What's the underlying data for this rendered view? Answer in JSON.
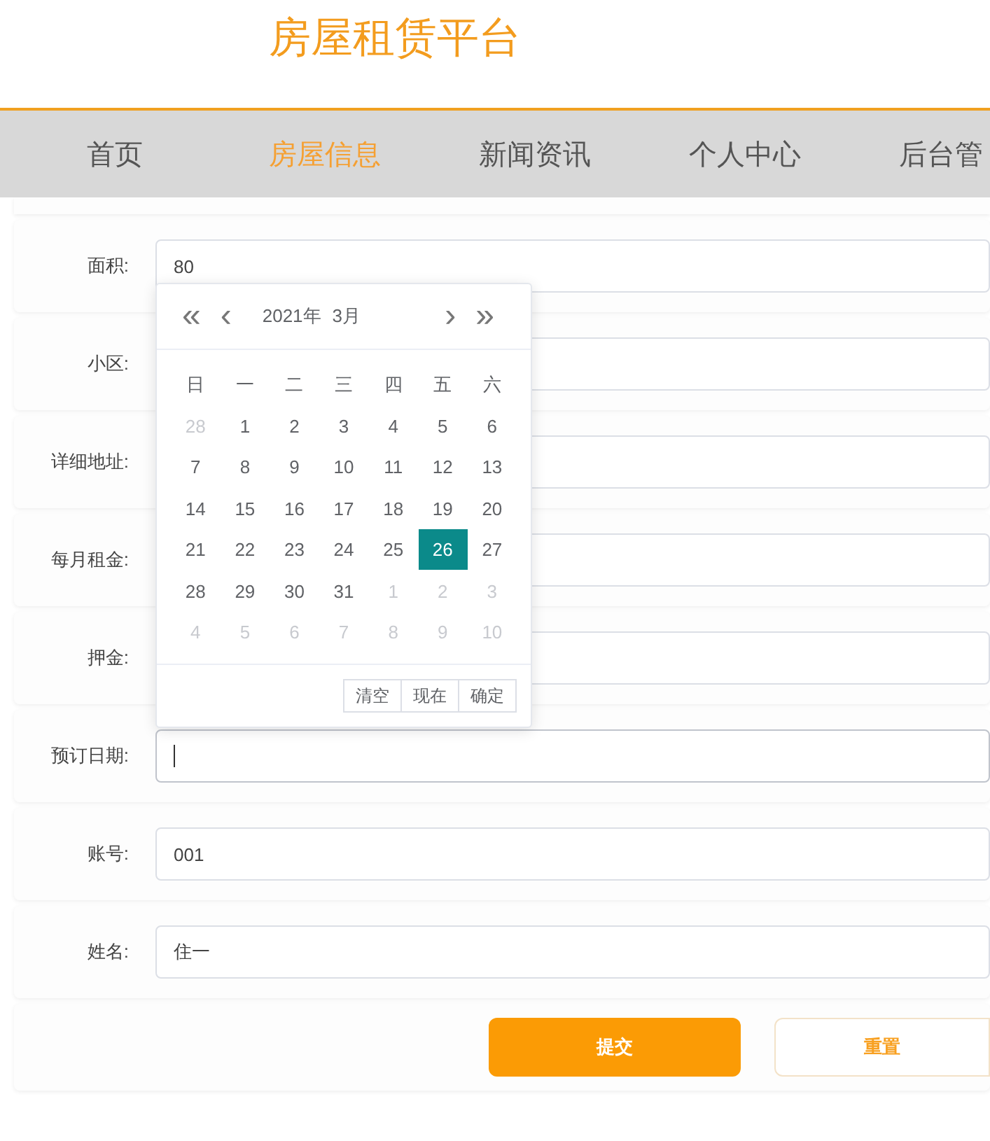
{
  "site_title": "房屋租赁平台",
  "nav": [
    {
      "label": "首页",
      "selected": false
    },
    {
      "label": "房屋信息",
      "selected": true
    },
    {
      "label": "新闻资讯",
      "selected": false
    },
    {
      "label": "个人中心",
      "selected": false
    },
    {
      "label": "后台管",
      "selected": false
    }
  ],
  "form": {
    "fields": [
      {
        "label": "面积:",
        "value": "80",
        "focused": false
      },
      {
        "label": "小区:",
        "focused": false
      },
      {
        "label": "详细地址:",
        "focused": false
      },
      {
        "label": "每月租金:",
        "focused": false
      },
      {
        "label": "押金:",
        "focused": false
      },
      {
        "label": "预订日期:",
        "focused": true
      },
      {
        "label": "账号:",
        "value": "001",
        "focused": false
      },
      {
        "label": "姓名:",
        "value": "住一",
        "focused": false
      }
    ],
    "buttons": [
      {
        "label": "提交",
        "kind": "primary"
      },
      {
        "label": "重置",
        "kind": "secondary"
      }
    ]
  },
  "date_picker": {
    "prev_year": "«",
    "prev_month": "‹",
    "year": "2021年",
    "month": "3月",
    "next_month": "›",
    "next_year": "»",
    "weekdays": [
      "日",
      "一",
      "二",
      "三",
      "四",
      "五",
      "六"
    ],
    "days": [
      {
        "label": "28",
        "other_month": true,
        "selected": false
      },
      {
        "label": "1",
        "other_month": false,
        "selected": false
      },
      {
        "label": "2",
        "other_month": false,
        "selected": false
      },
      {
        "label": "3",
        "other_month": false,
        "selected": false
      },
      {
        "label": "4",
        "other_month": false,
        "selected": false
      },
      {
        "label": "5",
        "other_month": false,
        "selected": false
      },
      {
        "label": "6",
        "other_month": false,
        "selected": false
      },
      {
        "label": "7",
        "other_month": false,
        "selected": false
      },
      {
        "label": "8",
        "other_month": false,
        "selected": false
      },
      {
        "label": "9",
        "other_month": false,
        "selected": false
      },
      {
        "label": "10",
        "other_month": false,
        "selected": false
      },
      {
        "label": "11",
        "other_month": false,
        "selected": false
      },
      {
        "label": "12",
        "other_month": false,
        "selected": false
      },
      {
        "label": "13",
        "other_month": false,
        "selected": false
      },
      {
        "label": "14",
        "other_month": false,
        "selected": false
      },
      {
        "label": "15",
        "other_month": false,
        "selected": false
      },
      {
        "label": "16",
        "other_month": false,
        "selected": false
      },
      {
        "label": "17",
        "other_month": false,
        "selected": false
      },
      {
        "label": "18",
        "other_month": false,
        "selected": false
      },
      {
        "label": "19",
        "other_month": false,
        "selected": false
      },
      {
        "label": "20",
        "other_month": false,
        "selected": false
      },
      {
        "label": "21",
        "other_month": false,
        "selected": false
      },
      {
        "label": "22",
        "other_month": false,
        "selected": false
      },
      {
        "label": "23",
        "other_month": false,
        "selected": false
      },
      {
        "label": "24",
        "other_month": false,
        "selected": false
      },
      {
        "label": "25",
        "other_month": false,
        "selected": false
      },
      {
        "label": "26",
        "other_month": false,
        "selected": true
      },
      {
        "label": "27",
        "other_month": false,
        "selected": false
      },
      {
        "label": "28",
        "other_month": false,
        "selected": false
      },
      {
        "label": "29",
        "other_month": false,
        "selected": false
      },
      {
        "label": "30",
        "other_month": false,
        "selected": false
      },
      {
        "label": "31",
        "other_month": false,
        "selected": false
      },
      {
        "label": "1",
        "other_month": true,
        "selected": false
      },
      {
        "label": "2",
        "other_month": true,
        "selected": false
      },
      {
        "label": "3",
        "other_month": true,
        "selected": false
      },
      {
        "label": "4",
        "other_month": true,
        "selected": false
      },
      {
        "label": "5",
        "other_month": true,
        "selected": false
      },
      {
        "label": "6",
        "other_month": true,
        "selected": false
      },
      {
        "label": "7",
        "other_month": true,
        "selected": false
      },
      {
        "label": "8",
        "other_month": true,
        "selected": false
      },
      {
        "label": "9",
        "other_month": true,
        "selected": false
      },
      {
        "label": "10",
        "other_month": true,
        "selected": false
      }
    ],
    "buttons": [
      "清空",
      "现在",
      "确定"
    ]
  }
}
